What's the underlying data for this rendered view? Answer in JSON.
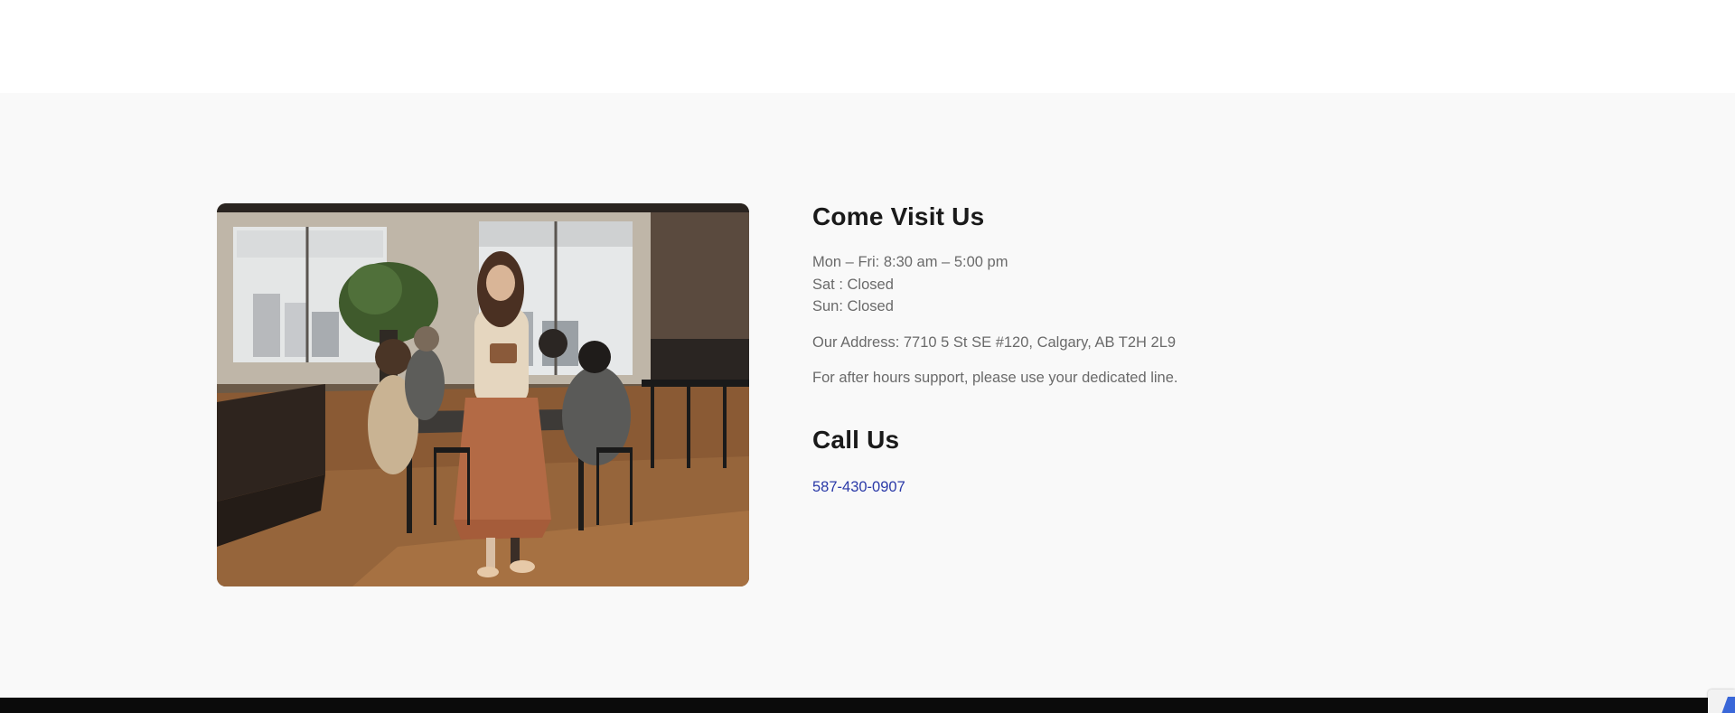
{
  "visit": {
    "heading": "Come Visit Us",
    "hours": [
      "Mon – Fri: 8:30 am – 5:00 pm",
      "Sat : Closed",
      "Sun: Closed"
    ],
    "address": "Our Address: 7710 5 St SE #120, Calgary, AB T2H 2L9",
    "support": "For after hours support, please use your dedicated line."
  },
  "call": {
    "heading": "Call Us",
    "phone": "587-430-0907"
  },
  "colors": {
    "section_bg": "#f9f9f9",
    "heading": "#1a1a1a",
    "body_text": "#6a6a6a",
    "link": "#2b3aa8",
    "footer": "#0b0b0b"
  },
  "icons": {
    "corner_badge": "recaptcha-icon"
  }
}
